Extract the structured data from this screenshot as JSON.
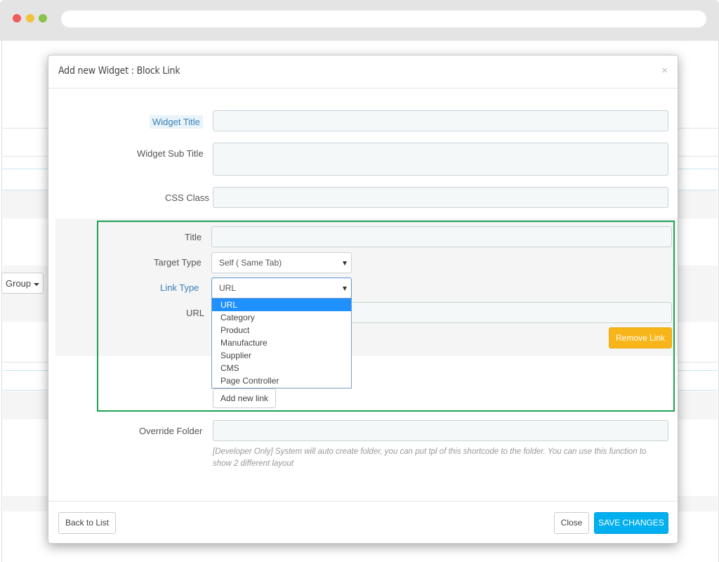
{
  "modal": {
    "title": "Add new Widget : Block Link",
    "close_symbol": "×"
  },
  "form": {
    "widget_title_label": "Widget Title",
    "widget_sub_title_label": "Widget Sub Title",
    "css_class_label": "CSS Class",
    "override_folder_label": "Override Folder",
    "override_folder_help": "[Developer Only] System will auto create folder, you can put tpl of this shortcode to the folder. You can use this function to show 2 different layout"
  },
  "link_block": {
    "title_label": "Title",
    "target_type_label": "Target Type",
    "target_type_value": "Self ( Same Tab)",
    "link_type_label": "Link Type",
    "link_type_value": "URL",
    "url_label": "URL",
    "remove_link_label": "Remove Link",
    "add_new_link_label": "Add new link",
    "link_type_options": [
      "URL",
      "Category",
      "Product",
      "Manufacture",
      "Supplier",
      "CMS",
      "Page Controller"
    ],
    "selected_option": "URL"
  },
  "footer": {
    "back_to_list_label": "Back to List",
    "close_label": "Close",
    "save_changes_label": "SAVE CHANGES"
  },
  "background": {
    "group_button_label": "Group"
  },
  "colors": {
    "save_button": "#00aff0",
    "remove_button": "#f8b519",
    "highlight_box": "#1ea055",
    "dropdown_selected": "#1e90ff"
  }
}
